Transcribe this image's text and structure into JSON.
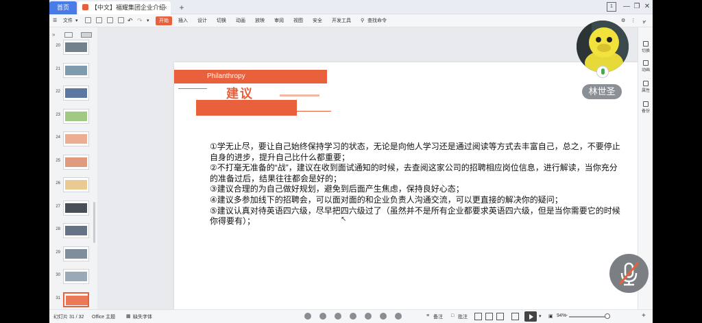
{
  "titlebar": {
    "home_tab": "首页",
    "doc_tab": "【中文】福耀集团企业介绍PPT",
    "close_tab": "×",
    "add_tab": "+",
    "page_counter": "1"
  },
  "menubar": {
    "file": "文件",
    "items": [
      "开始",
      "插入",
      "设计",
      "切换",
      "动画",
      "放映",
      "审阅",
      "视图",
      "安全",
      "开发工具"
    ],
    "search": "查找命令"
  },
  "thumbnails": [
    {
      "num": "20",
      "color": "#5a6a7a"
    },
    {
      "num": "21",
      "color": "#6a8aa0"
    },
    {
      "num": "22",
      "color": "#3f5f8f"
    },
    {
      "num": "23",
      "color": "#8fbf6f"
    },
    {
      "num": "24",
      "color": "#e8a080"
    },
    {
      "num": "25",
      "color": "#d98a6a"
    },
    {
      "num": "26",
      "color": "#e8c080"
    },
    {
      "num": "27",
      "color": "#2a2f3a"
    },
    {
      "num": "28",
      "color": "#4a5a70"
    },
    {
      "num": "29",
      "color": "#6a7a8a"
    },
    {
      "num": "30",
      "color": "#8a9aaa"
    },
    {
      "num": "31",
      "color": "#e8603c"
    }
  ],
  "slide": {
    "banner": "Philanthropy",
    "heading": "建议",
    "body": [
      "①学无止尽，要让自己始终保持学习的状态，无论是向他人学习还是通过阅读等方式去丰富自己，总之，不要停止自身的进步，提升自己比什么都重要；",
      "②不打毫无准备的“战”，建议在收到面试通知的时候，去查阅这家公司的招聘相应岗位信息，进行解读，当你充分的准备过后，结果往往都会是好的；",
      "③建议合理的为自己做好规划，避免到后面产生焦虑，保持良好心态；",
      "④建议多参加线下的招聘会，可以面对面的和企业负责人沟通交流，可以更直接的解决你的疑问；",
      "⑤建议认真对待英语四六级，尽早把四六级过了（虽然并不是所有企业都要求英语四六级，但是当你需要它的时候你得要有）；"
    ]
  },
  "rightbar": [
    "切换",
    "动画",
    "属性",
    "备份"
  ],
  "statusbar": {
    "slide_info": "幻灯片 31 / 32",
    "theme": "Office 主题",
    "missing_font": "缺失字体",
    "notes": "备注",
    "comments": "批注",
    "zoom": "94%",
    "zoom_plus": "+"
  },
  "overlay": {
    "username": "林世圣"
  },
  "colors": {
    "accent": "#e8603c",
    "home_tab": "#4a7ce8"
  }
}
